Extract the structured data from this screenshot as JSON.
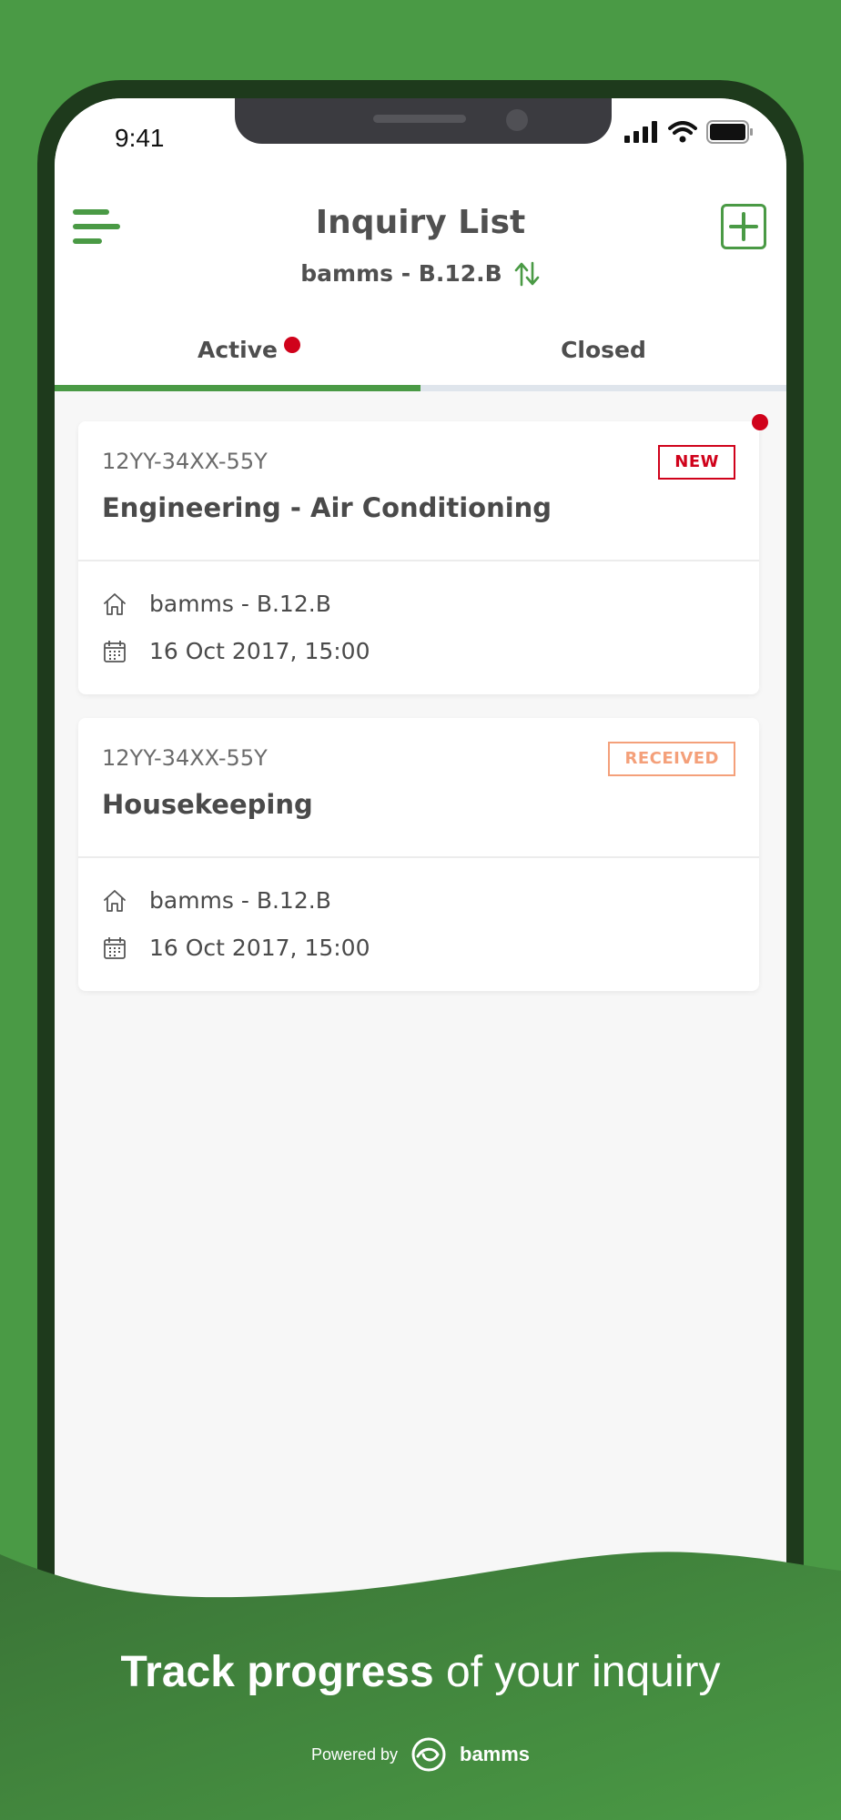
{
  "status_bar": {
    "time": "9:41"
  },
  "header": {
    "title": "Inquiry List",
    "location": "bamms - B.12.B"
  },
  "tabs": [
    {
      "label": "Active",
      "active": true,
      "has_notification": true
    },
    {
      "label": "Closed",
      "active": false,
      "has_notification": false
    }
  ],
  "inquiries": [
    {
      "code": "12YY-34XX-55Y",
      "title": "Engineering - Air Conditioning",
      "status": "NEW",
      "location": "bamms - B.12.B",
      "datetime": "16 Oct 2017, 15:00",
      "unread": true
    },
    {
      "code": "12YY-34XX-55Y",
      "title": "Housekeeping",
      "status": "RECEIVED",
      "location": "bamms - B.12.B",
      "datetime": "16 Oct 2017, 15:00",
      "unread": false
    }
  ],
  "tagline": {
    "bold": "Track progress",
    "light": " of your inquiry"
  },
  "footer": {
    "powered_by": "Powered by",
    "brand": "bamms"
  },
  "colors": {
    "brand_green": "#4a9a45",
    "notification_red": "#d0021b",
    "received_orange": "#f4a07a"
  },
  "icons": [
    "hamburger-menu-icon",
    "add-square-icon",
    "swap-vertical-icon",
    "home-icon",
    "calendar-icon",
    "signal-icon",
    "wifi-icon",
    "battery-icon",
    "bamms-logo-icon"
  ]
}
